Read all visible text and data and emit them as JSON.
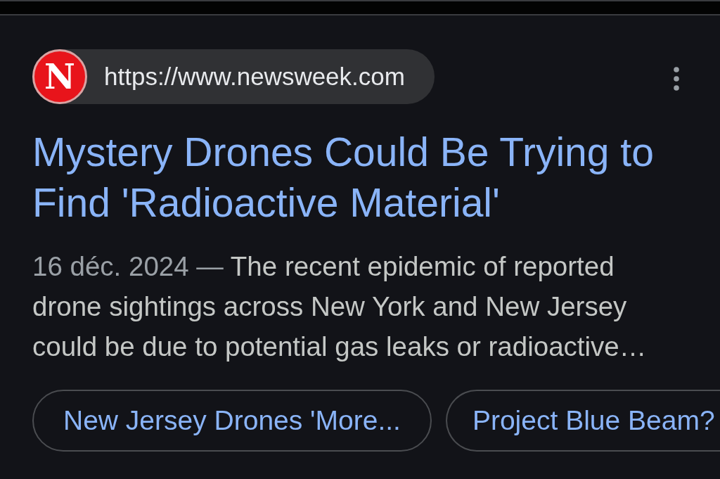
{
  "result": {
    "favicon_letter": "N",
    "url": "https://www.newsweek.com",
    "title": "Mystery Drones Could Be Trying to Find 'Radioactive Material'",
    "date": "16 déc. 2024",
    "separator": "—",
    "snippet": "The recent epidemic of reported drone sightings across New York and New Jersey could be due to potential gas leaks or radioactive…",
    "related_searches": [
      {
        "label": "New Jersey Drones 'More...",
        "cut_off": false
      },
      {
        "label": "Project Blue Beam?",
        "cut_off": true
      }
    ]
  }
}
